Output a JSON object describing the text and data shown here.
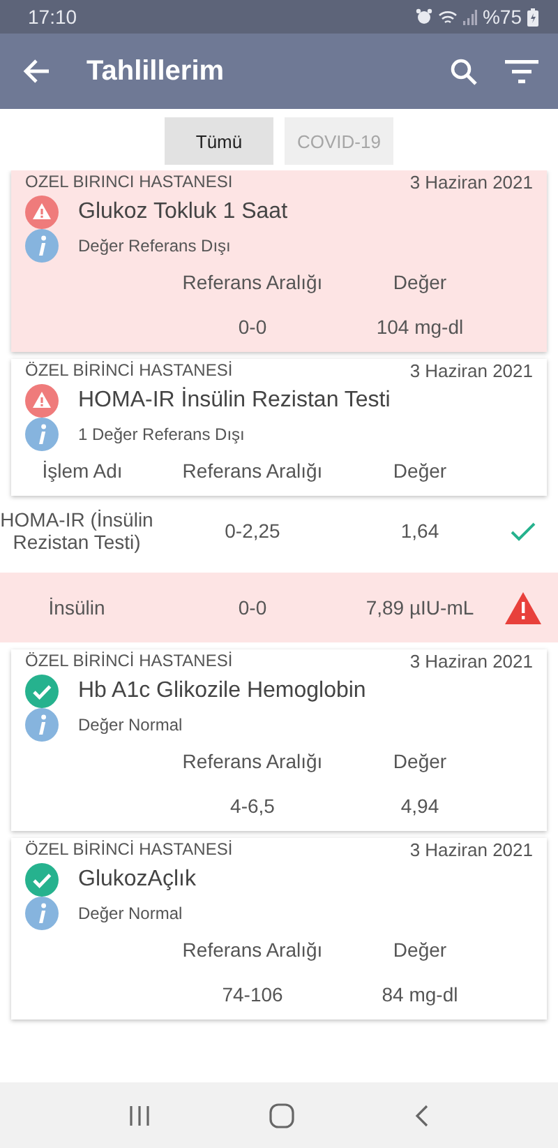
{
  "status_bar": {
    "time": "17:10",
    "battery": "%75"
  },
  "app_bar": {
    "title": "Tahlillerim"
  },
  "tabs": [
    {
      "label": "Tümü",
      "selected": true
    },
    {
      "label": "COVID-19",
      "selected": false
    }
  ],
  "results": [
    {
      "hospital": "OZEL BIRINCI HASTANESI",
      "date": "3 Haziran 2021",
      "out_of_range": true,
      "highlighted": true,
      "name": "Glukoz Tokluk 1 Saat",
      "summary": "Değer Referans Dışı",
      "columns": [
        "",
        "Referans Aralığı",
        "Değer"
      ],
      "rows": [
        {
          "range": "0-0",
          "value": "104 mg-dl"
        }
      ]
    },
    {
      "hospital": "ÖZEL BİRİNCİ HASTANESİ",
      "date": "3 Haziran 2021",
      "out_of_range": true,
      "highlighted": false,
      "name": "HOMA-IR İnsülin Rezistan Testi",
      "summary": "1 Değer Referans Dışı",
      "columns": [
        "İşlem Adı",
        "Referans Aralığı",
        "Değer"
      ],
      "details": [
        {
          "name": "HOMA-IR (İnsülin Rezistan Testi)",
          "range": "0-2,25",
          "value": "1,64",
          "out_of_range": false
        },
        {
          "name": "İnsülin",
          "range": "0-0",
          "value": "7,89 µIU-mL",
          "out_of_range": true
        }
      ]
    },
    {
      "hospital": "ÖZEL BİRİNCİ HASTANESİ",
      "date": "3 Haziran 2021",
      "out_of_range": false,
      "highlighted": false,
      "name": "Hb A1c Glikozile Hemoglobin",
      "summary": "Değer Normal",
      "columns": [
        "",
        "Referans Aralığı",
        "Değer"
      ],
      "rows": [
        {
          "range": "4-6,5",
          "value": "4,94"
        }
      ]
    },
    {
      "hospital": "ÖZEL BİRİNCİ HASTANESİ",
      "date": "3 Haziran 2021",
      "out_of_range": false,
      "highlighted": false,
      "name": "GlukozAçlık",
      "summary": "Değer Normal",
      "columns": [
        "",
        "Referans Aralığı",
        "Değer"
      ],
      "rows": [
        {
          "range": "74-106",
          "value": "84 mg-dl"
        }
      ]
    }
  ]
}
